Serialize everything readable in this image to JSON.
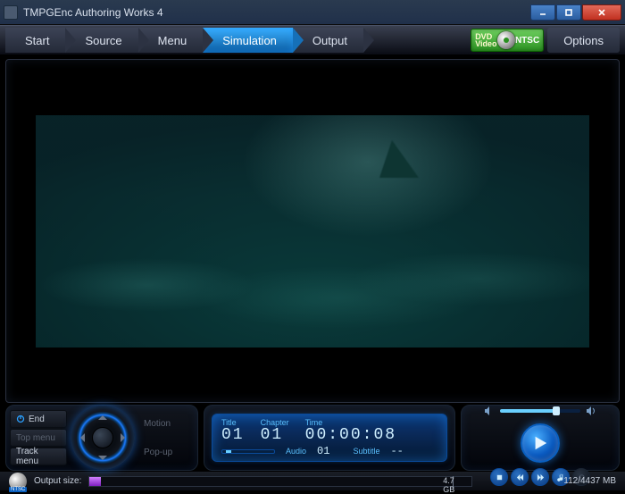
{
  "window": {
    "title": "TMPGEnc Authoring Works 4"
  },
  "tabs": {
    "start": "Start",
    "source": "Source",
    "menu": "Menu",
    "simulation": "Simulation",
    "output": "Output",
    "options": "Options"
  },
  "format_badge": {
    "line1": "DVD",
    "line2": "Video",
    "standard": "NTSC"
  },
  "nav": {
    "end": "End",
    "top_menu": "Top menu",
    "track_menu": "Track menu",
    "motion": "Motion",
    "popup": "Pop-up"
  },
  "lcd": {
    "title_label": "Title",
    "title_value": "01",
    "chapter_label": "Chapter",
    "chapter_value": "01",
    "time_label": "Time",
    "time_value": "00:00:08",
    "audio_label": "Audio",
    "audio_value": "01",
    "subtitle_label": "Subtitle",
    "subtitle_value": "--"
  },
  "footer": {
    "output_label": "Output size:",
    "marker": "4.7 GB",
    "memory": "112/4437 MB",
    "disc_standard": "NTSC"
  }
}
